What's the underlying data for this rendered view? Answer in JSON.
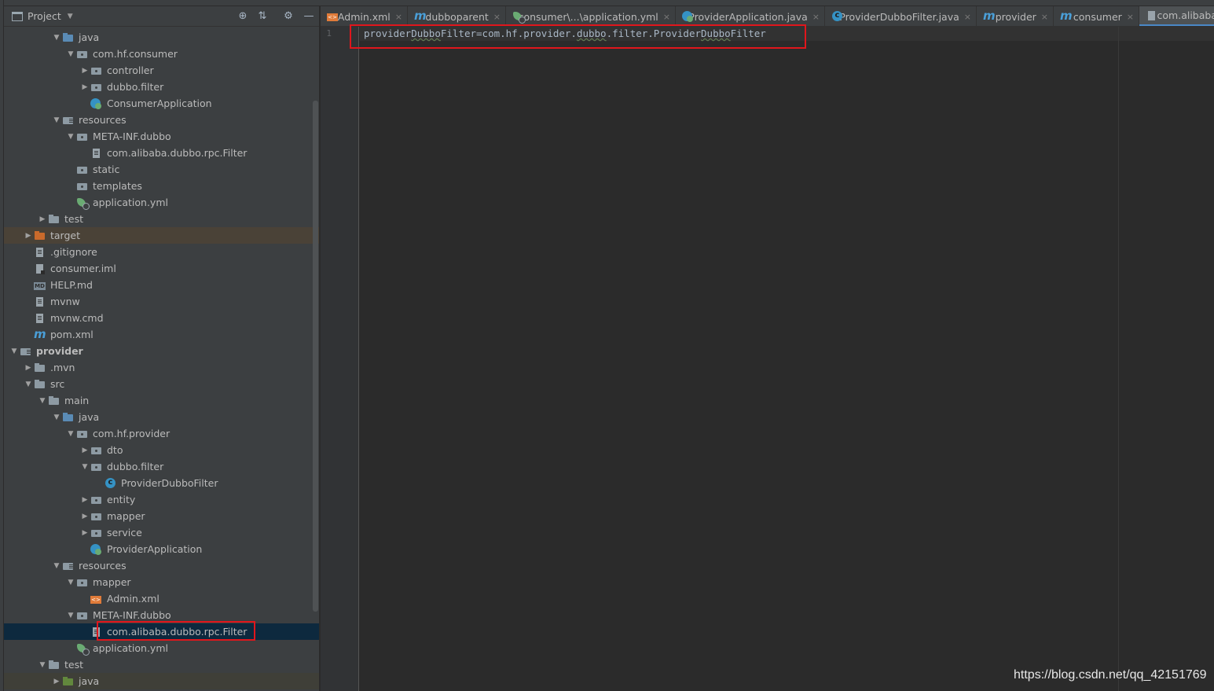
{
  "panel": {
    "title": "Project",
    "dropdown_icon": "chevron-down-icon",
    "tools": [
      "locate-icon",
      "collapse-all-icon",
      "gear-icon",
      "minimize-icon"
    ]
  },
  "tree": [
    {
      "label": "java",
      "arrow": "▼",
      "icon": "folder-blue",
      "bold": false
    },
    {
      "label": "com.hf.consumer",
      "arrow": "▼",
      "icon": "pkg",
      "bold": false
    },
    {
      "label": "controller",
      "arrow": "▶",
      "icon": "pkg",
      "bold": false
    },
    {
      "label": "dubbo.filter",
      "arrow": "▶",
      "icon": "pkg",
      "bold": false
    },
    {
      "label": "ConsumerApplication",
      "arrow": "",
      "icon": "spring",
      "bold": false
    },
    {
      "label": "resources",
      "arrow": "▼",
      "icon": "res",
      "bold": false
    },
    {
      "label": "META-INF.dubbo",
      "arrow": "▼",
      "icon": "pkg",
      "bold": false
    },
    {
      "label": "com.alibaba.dubbo.rpc.Filter",
      "arrow": "",
      "icon": "file",
      "bold": false
    },
    {
      "label": "static",
      "arrow": "",
      "icon": "pkg",
      "bold": false
    },
    {
      "label": "templates",
      "arrow": "",
      "icon": "pkg",
      "bold": false
    },
    {
      "label": "application.yml",
      "arrow": "",
      "icon": "yml",
      "bold": false
    },
    {
      "label": "test",
      "arrow": "▶",
      "icon": "folder",
      "bold": false
    },
    {
      "label": "target",
      "arrow": "▶",
      "icon": "folder-orange",
      "bold": false
    },
    {
      "label": ".gitignore",
      "arrow": "",
      "icon": "file",
      "bold": false
    },
    {
      "label": "consumer.iml",
      "arrow": "",
      "icon": "iml",
      "bold": false
    },
    {
      "label": "HELP.md",
      "arrow": "",
      "icon": "md",
      "bold": false
    },
    {
      "label": "mvnw",
      "arrow": "",
      "icon": "file",
      "bold": false
    },
    {
      "label": "mvnw.cmd",
      "arrow": "",
      "icon": "file",
      "bold": false
    },
    {
      "label": "pom.xml",
      "arrow": "",
      "icon": "maven",
      "bold": false
    },
    {
      "label": "provider",
      "arrow": "▼",
      "icon": "res",
      "bold": true
    },
    {
      "label": ".mvn",
      "arrow": "▶",
      "icon": "folder",
      "bold": false
    },
    {
      "label": "src",
      "arrow": "▼",
      "icon": "folder",
      "bold": false
    },
    {
      "label": "main",
      "arrow": "▼",
      "icon": "folder",
      "bold": false
    },
    {
      "label": "java",
      "arrow": "▼",
      "icon": "folder-blue",
      "bold": false
    },
    {
      "label": "com.hf.provider",
      "arrow": "▼",
      "icon": "pkg",
      "bold": false
    },
    {
      "label": "dto",
      "arrow": "▶",
      "icon": "pkg",
      "bold": false
    },
    {
      "label": "dubbo.filter",
      "arrow": "▼",
      "icon": "pkg",
      "bold": false
    },
    {
      "label": "ProviderDubboFilter",
      "arrow": "",
      "icon": "class",
      "bold": false
    },
    {
      "label": "entity",
      "arrow": "▶",
      "icon": "pkg",
      "bold": false
    },
    {
      "label": "mapper",
      "arrow": "▶",
      "icon": "pkg",
      "bold": false
    },
    {
      "label": "service",
      "arrow": "▶",
      "icon": "pkg",
      "bold": false
    },
    {
      "label": "ProviderApplication",
      "arrow": "",
      "icon": "spring",
      "bold": false
    },
    {
      "label": "resources",
      "arrow": "▼",
      "icon": "res",
      "bold": false
    },
    {
      "label": "mapper",
      "arrow": "▼",
      "icon": "pkg",
      "bold": false
    },
    {
      "label": "Admin.xml",
      "arrow": "",
      "icon": "xml",
      "bold": false
    },
    {
      "label": "META-INF.dubbo",
      "arrow": "▼",
      "icon": "pkg",
      "bold": false
    },
    {
      "label": "com.alibaba.dubbo.rpc.Filter",
      "arrow": "",
      "icon": "file",
      "bold": false
    },
    {
      "label": "application.yml",
      "arrow": "",
      "icon": "yml",
      "bold": false
    },
    {
      "label": "test",
      "arrow": "▼",
      "icon": "folder",
      "bold": false
    },
    {
      "label": "java",
      "arrow": "▶",
      "icon": "folder-green",
      "bold": false
    }
  ],
  "tabs": [
    {
      "label": "Admin.xml",
      "icon": "xml",
      "close": "×"
    },
    {
      "label": "dubboparent",
      "icon": "maven",
      "close": "×"
    },
    {
      "label": "consumer\\...\\application.yml",
      "icon": "yml",
      "close": "×"
    },
    {
      "label": "ProviderApplication.java",
      "icon": "spring",
      "close": "×"
    },
    {
      "label": "ProviderDubboFilter.java",
      "icon": "class",
      "close": "×"
    },
    {
      "label": "provider",
      "icon": "maven",
      "close": "×"
    },
    {
      "label": "consumer",
      "icon": "maven",
      "close": "×"
    },
    {
      "label": "com.alibaba",
      "icon": "file",
      "close": ""
    }
  ],
  "editor": {
    "line_number": "1",
    "code": {
      "p1": "provider",
      "p2": "Dubbo",
      "p3": "Filter=com.hf.provider.",
      "p4": "dubbo",
      "p5": ".filter.Provider",
      "p6": "Dubbo",
      "p7": "Filter"
    }
  },
  "watermark": "https://blog.csdn.net/qq_42151769",
  "colors": {
    "panel_bg": "#3c3f41",
    "editor_bg": "#2b2b2b",
    "selection": "#0d293e",
    "annotation_red": "#e0161c",
    "active_tab_underline": "#4a88c7"
  }
}
